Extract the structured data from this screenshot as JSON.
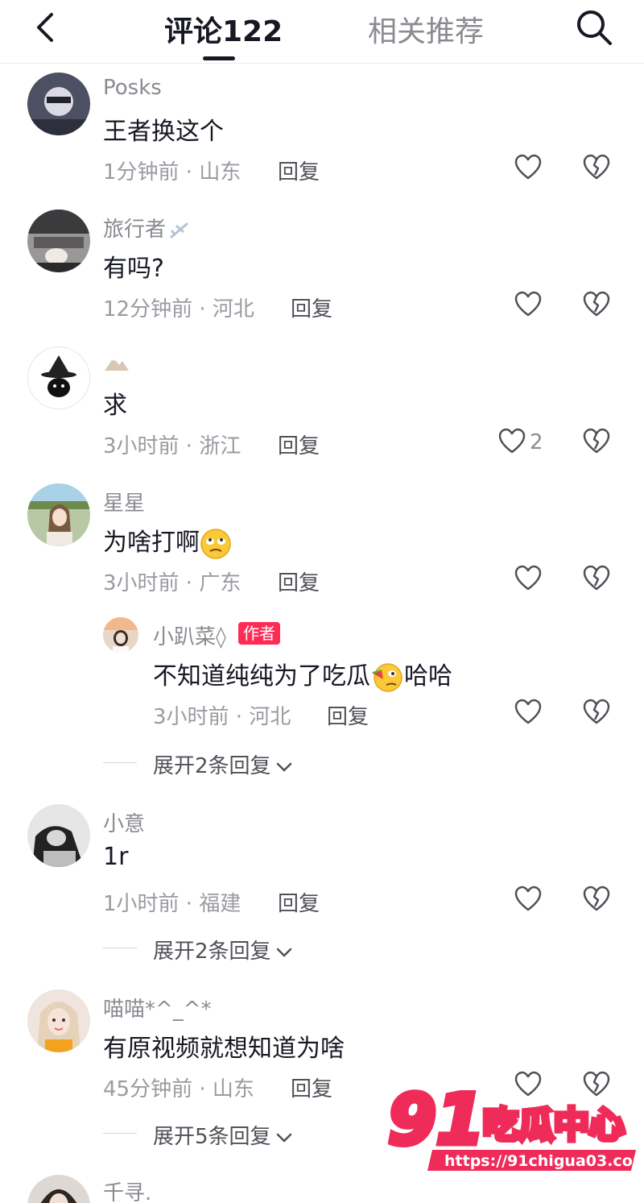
{
  "header": {
    "tab_comments": "评论122",
    "tab_related": "相关推荐"
  },
  "comments": [
    {
      "user": "Posks",
      "text": "王者换这个",
      "time": "1分钟前 · 山东",
      "reply": "回复"
    },
    {
      "user": "旅行者",
      "text": "有吗?",
      "time": "12分钟前 · 河北",
      "reply": "回复"
    },
    {
      "user": "",
      "text": "求",
      "time": "3小时前 · 浙江",
      "reply": "回复",
      "likes": "2"
    },
    {
      "user": "星星",
      "text": "为啥打啊",
      "time": "3小时前 · 广东",
      "reply": "回复"
    },
    {
      "user": "小意",
      "text": "1r",
      "time": "1小时前 · 福建",
      "reply": "回复",
      "expand": "展开2条回复"
    },
    {
      "user": "喵喵*^_^*",
      "text": "有原视频就想知道为啥",
      "time": "45分钟前 · 山东",
      "reply": "回复",
      "expand": "展开5条回复"
    },
    {
      "user": "千寻."
    }
  ],
  "sub_reply": {
    "user": "小趴菜◊",
    "badge": "作者",
    "text": "不知道纯纯为了吃瓜",
    "text_suffix": "哈哈",
    "time": "3小时前 · 河北",
    "reply": "回复",
    "expand": "展开2条回复"
  },
  "watermark": {
    "brand_number": "91",
    "brand_text": "吃瓜中心",
    "url": "https://91chigua03.com"
  },
  "colors": {
    "accent": "#fe2c55",
    "text": "#161823",
    "muted": "#8a8b91"
  },
  "icons": [
    "back-arrow-icon",
    "search-icon",
    "heart-icon",
    "broken-heart-icon",
    "chevron-down-icon"
  ]
}
